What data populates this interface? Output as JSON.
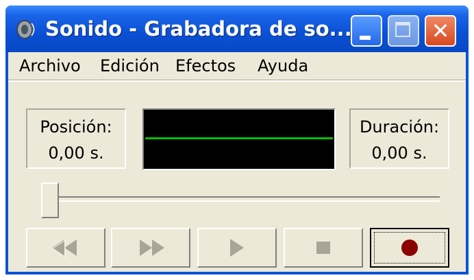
{
  "window": {
    "title": "Sonido - Grabadora de so...",
    "icon": "speaker-icon",
    "controls": [
      "minimize-icon",
      "maximize-icon",
      "close-icon"
    ]
  },
  "menu": {
    "items": [
      {
        "label": "Archivo"
      },
      {
        "label": "Edición"
      },
      {
        "label": "Efectos"
      },
      {
        "label": "Ayuda"
      }
    ]
  },
  "position": {
    "label": "Posición:",
    "value": "0,00 s."
  },
  "duration": {
    "label": "Duración:",
    "value": "0,00 s."
  },
  "waveform": {
    "background": "#000000",
    "line_color": "#00c000"
  },
  "slider": {
    "position_fraction": 0
  },
  "transport": {
    "buttons": [
      {
        "name": "rewind",
        "icon": "rewind-icon",
        "enabled": false
      },
      {
        "name": "fast-forward",
        "icon": "fast-forward-icon",
        "enabled": false
      },
      {
        "name": "play",
        "icon": "play-icon",
        "enabled": false
      },
      {
        "name": "stop",
        "icon": "stop-icon",
        "enabled": false
      },
      {
        "name": "record",
        "icon": "record-icon",
        "enabled": true,
        "color": "#8b0000"
      }
    ]
  }
}
